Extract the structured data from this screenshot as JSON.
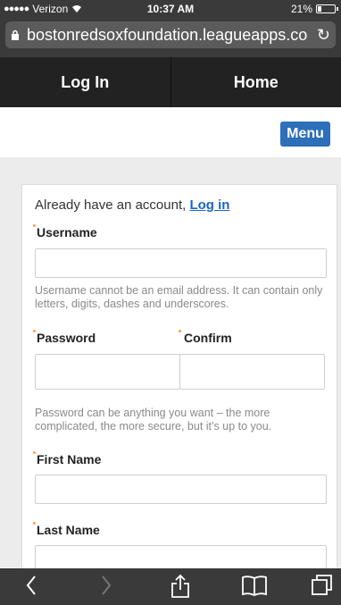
{
  "status": {
    "carrier": "Verizon",
    "time": "10:37 AM",
    "battery": "21%",
    "battery_level": 0.21
  },
  "url": "bostonredsoxfoundation.leagueapps.co",
  "nav": {
    "login": "Log In",
    "home": "Home"
  },
  "menu": "Menu",
  "form": {
    "already_text": "Already have an account, ",
    "login_link": "Log in",
    "username_label": "Username",
    "username_value": "",
    "username_help": "Username cannot be an email address. It can contain only letters, digits, dashes and underscores.",
    "password_label": "Password",
    "password_value": "",
    "confirm_label": "Confirm",
    "confirm_value": "",
    "password_help": "Password can be anything you want – the more complicated, the more secure, but it’s up to you.",
    "firstname_label": "First Name",
    "firstname_value": "",
    "lastname_label": "Last Name",
    "lastname_value": ""
  },
  "toolbar": {
    "back": "back-icon",
    "forward": "forward-icon",
    "share": "share-icon",
    "bookmarks": "book-icon",
    "tabs": "tabs-icon"
  }
}
